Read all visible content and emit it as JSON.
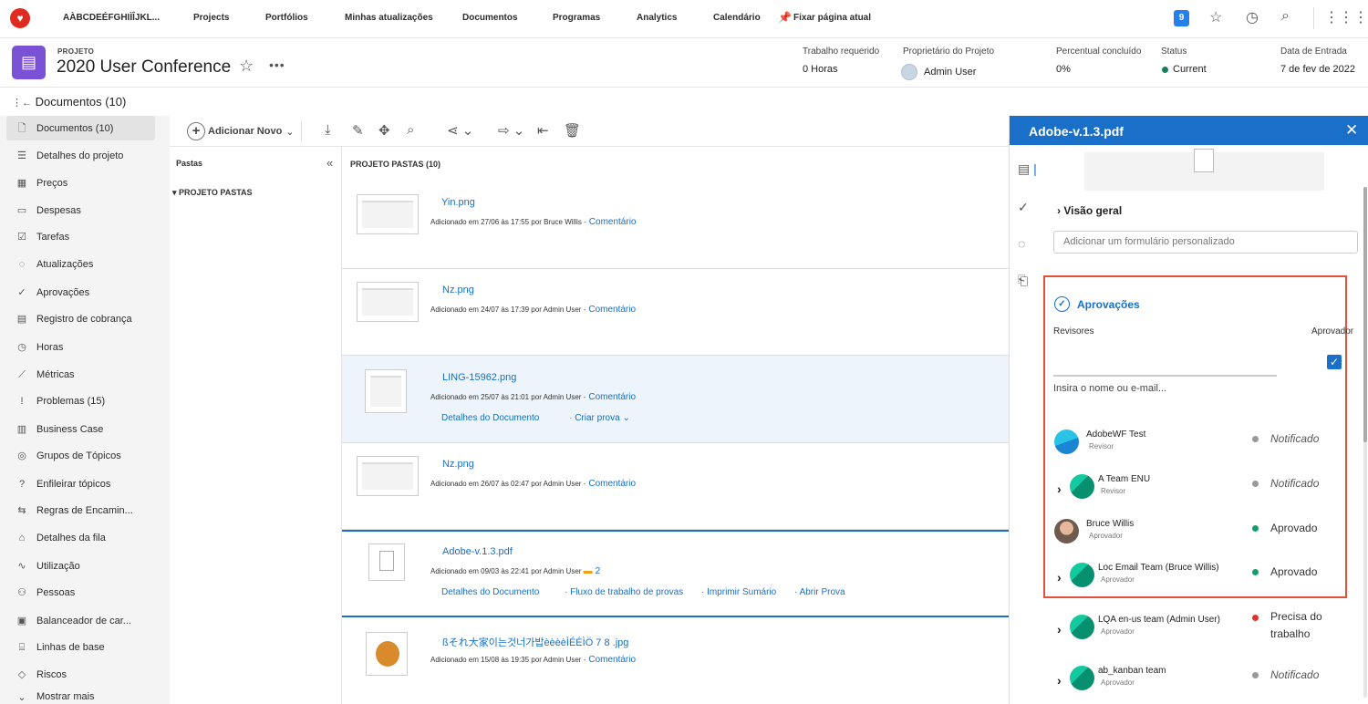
{
  "topnav": {
    "org": "AÀBCDEÉFGHIÌÎJKL...",
    "items": [
      "Projects",
      "Portfólios",
      "Minhas atualizações",
      "Documentos",
      "Programas",
      "Analytics",
      "Calendário"
    ],
    "pin_label": "Fixar página atual",
    "notification_count": "9"
  },
  "project": {
    "label": "PROJETO",
    "title": "2020 User Conference",
    "meta": {
      "work_label": "Trabalho requerido",
      "work_value": "0 Horas",
      "owner_label": "Proprietário do Projeto",
      "owner_value": "Admin User",
      "pct_label": "Percentual concluído",
      "pct_value": "0%",
      "status_label": "Status",
      "status_value": "Current",
      "date_label": "Data de Entrada",
      "date_value": "7 de fev de 2022"
    },
    "status_color": "#12805c"
  },
  "page_title": "Documentos (10)",
  "sidebar": {
    "items": [
      {
        "label": "Documentos (10)",
        "icon": "document-icon"
      },
      {
        "label": "Detalhes do projeto",
        "icon": "details-icon"
      },
      {
        "label": "Preços",
        "icon": "pricing-icon"
      },
      {
        "label": "Despesas",
        "icon": "expenses-icon"
      },
      {
        "label": "Tarefas",
        "icon": "tasks-icon"
      },
      {
        "label": "Atualizações",
        "icon": "updates-icon"
      },
      {
        "label": "Aprovações",
        "icon": "approvals-icon"
      },
      {
        "label": "Registro de cobrança",
        "icon": "billing-icon"
      },
      {
        "label": "Horas",
        "icon": "clock-icon"
      },
      {
        "label": "Métricas",
        "icon": "metrics-icon"
      },
      {
        "label": "Problemas (15)",
        "icon": "issues-icon"
      },
      {
        "label": "Business Case",
        "icon": "business-case-icon"
      },
      {
        "label": "Grupos de Tópicos",
        "icon": "topic-groups-icon"
      },
      {
        "label": "Enfileirar tópicos",
        "icon": "queue-topics-icon"
      },
      {
        "label": "Regras de Encamin...",
        "icon": "routing-rules-icon"
      },
      {
        "label": "Detalhes da fila",
        "icon": "queue-details-icon"
      },
      {
        "label": "Utilização",
        "icon": "utilization-icon"
      },
      {
        "label": "Pessoas",
        "icon": "people-icon"
      },
      {
        "label": "Balanceador de car...",
        "icon": "workload-icon"
      },
      {
        "label": "Linhas de base",
        "icon": "baselines-icon"
      },
      {
        "label": "Riscos",
        "icon": "risks-icon"
      },
      {
        "label": "Mostrar mais",
        "icon": "chevron-down-icon"
      }
    ]
  },
  "toolbar": {
    "add_new": "Adicionar Novo"
  },
  "folders": {
    "header": "Pastas",
    "item": "PROJETO PASTAS"
  },
  "doclist": {
    "header": "PROJETO PASTAS (10)",
    "rows": [
      {
        "name": "Yin.png",
        "meta": "Adicionado em 27/06 às 17:55 por Bruce Willis",
        "link": "Comentário"
      },
      {
        "name": "Nz.png",
        "meta": "Adicionado em 24/07 às 17:39 por Admin User",
        "link": "Comentário"
      },
      {
        "name": "LING-15962.png",
        "meta": "Adicionado em 25/07 às 21:01 por Admin User",
        "link": "Comentário",
        "action1": "Detalhes do Documento",
        "action2": "Criar prova"
      },
      {
        "name": "Nz.png",
        "meta": "Adicionado em 26/07 às 02:47 por Admin User",
        "link": "Comentário"
      },
      {
        "name": "Adobe-v.1.3.pdf",
        "meta": "Adicionado em 09/03 às 22:41 por Admin User",
        "comment_count": "2",
        "action1": "Detalhes do Documento",
        "action2": "Fluxo de trabalho de provas",
        "action3": "Imprimir Sumário",
        "action4": "Abrir Prova"
      },
      {
        "name": "ßそれ大家이는것너가밥èèèèÌÉÉÌÖ 7 8 .jpg",
        "meta": "Adicionado em 15/08 às 19:35 por Admin User",
        "link": "Comentário"
      }
    ]
  },
  "panel": {
    "title": "Adobe-v.1.3.pdf",
    "overview": "Visão geral",
    "form_placeholder": "Adicionar um formulário personalizado",
    "approvals_title": "Aprovações",
    "reviewers_label": "Revisores",
    "approver_label": "Aprovador",
    "name_hint": "Insira o nome ou e-mail...",
    "reviewers": [
      {
        "name": "AdobeWF Test",
        "role": "Revisor",
        "status": "Notificado",
        "status_color": "#999999"
      },
      {
        "name": "A Team ENU",
        "role": "Revisor",
        "status": "Notificado",
        "status_color": "#999999"
      },
      {
        "name": "Bruce Willis",
        "role": "Aprovador",
        "status": "Aprovado",
        "status_color": "#12a06a"
      },
      {
        "name": "Loc Email Team (Bruce Willis)",
        "role": "Aprovador",
        "status": "Aprovado",
        "status_color": "#12a06a"
      },
      {
        "name": "LQA en-us team (Admin User)",
        "role": "Aprovador",
        "status": "Precisa do trabalho",
        "status_color": "#e0312a"
      },
      {
        "name": "ab_kanban team",
        "role": "Aprovador",
        "status": "Notificado",
        "status_color": "#999999"
      }
    ]
  },
  "colors": {
    "accent": "#1a6fc8",
    "highlight_box": "#e0533a",
    "project_icon": "#7b51d6"
  }
}
